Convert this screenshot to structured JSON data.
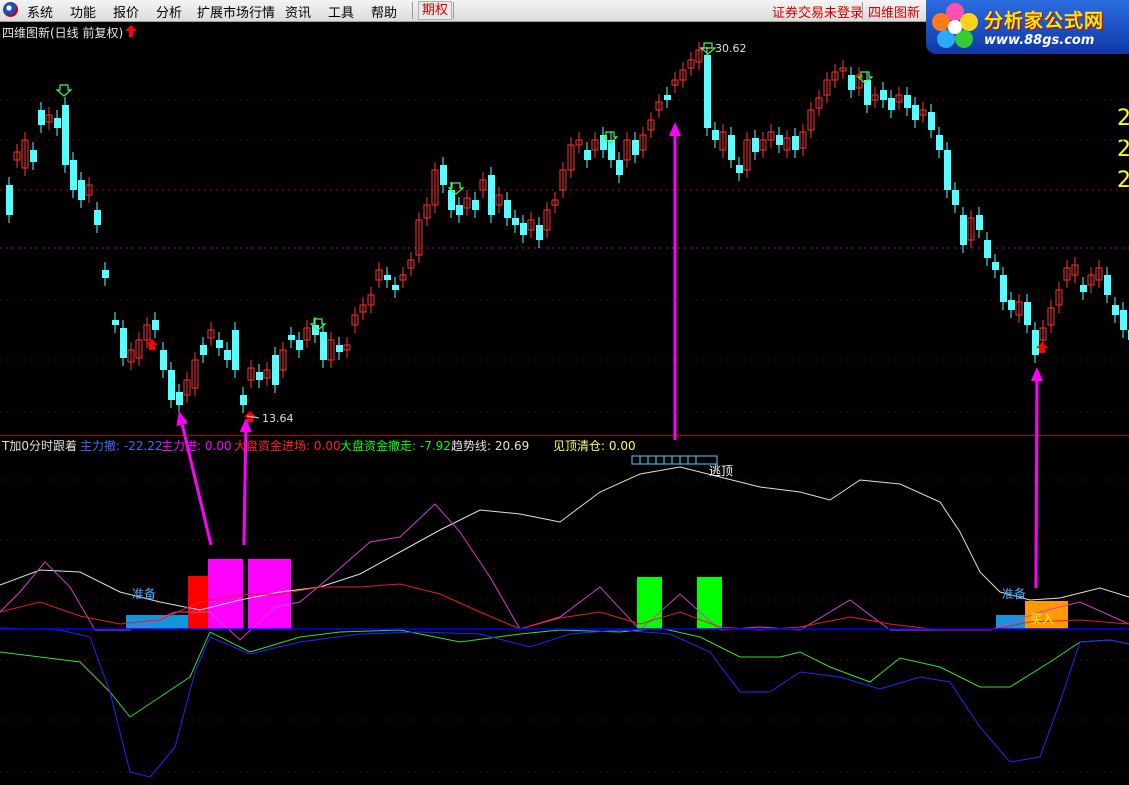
{
  "menu": {
    "items": [
      "系统",
      "功能",
      "报价",
      "分析",
      "扩展市场行情",
      "资讯",
      "工具",
      "帮助"
    ],
    "special": "期权",
    "login_status": "证券交易未登录",
    "formula_name": "四维图新"
  },
  "brand": {
    "title": "分析家公式网",
    "url": "www.88gs.com"
  },
  "main_chart": {
    "title": "四维图新(日线 前复权)",
    "high_label": "30.62",
    "low_label": "13.64",
    "right_digits": [
      "2",
      "2",
      "2"
    ]
  },
  "indicator": {
    "name": "T加0分时跟着",
    "values": [
      {
        "label": "主力撤:",
        "value": "-22.22",
        "color": "#3f6dff"
      },
      {
        "label": "主力进:",
        "value": "0.00",
        "color": "#ff00ff"
      },
      {
        "label": "大盘资金进场:",
        "value": "0.00",
        "color": "#ff2020"
      },
      {
        "label": "大盘资金撤走:",
        "value": "-7.92",
        "color": "#00ff00"
      },
      {
        "label": "趋势线:",
        "value": "20.69",
        "color": "#e0e0e0"
      },
      {
        "label": "见顶清仓:",
        "value": "0.00",
        "color": "#ffff66"
      }
    ],
    "signals": {
      "prepare": "准备",
      "escape_top": "逃顶",
      "buy": "买入"
    }
  },
  "colors": {
    "up_candle": "#ff3030",
    "down_candle": "#54ffff",
    "signal_red": "#ff0000",
    "signal_magenta": "#ff00ff",
    "signal_green": "#00ff00",
    "signal_cyan": "#1296db",
    "signal_orange": "#ff9900",
    "trend_line": "#e0e0e0",
    "zero_line": "#0000ff"
  },
  "icons": [
    "app-logo-icon",
    "up-arrow-icon",
    "down-arrow-icon",
    "brand-flower-icon"
  ]
}
